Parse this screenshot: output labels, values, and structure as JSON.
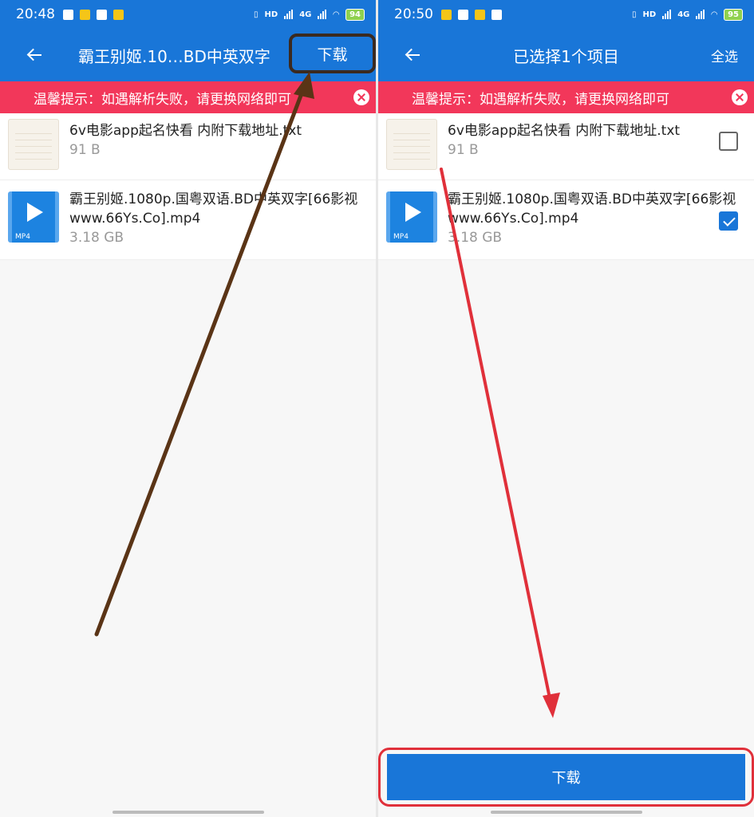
{
  "left": {
    "status": {
      "time": "20:48",
      "battery": "94"
    },
    "toolbar": {
      "title": "霸王别姬.10…BD中英双字",
      "action": "下载"
    },
    "banner": {
      "text": "温馨提示：如遇解析失败，请更换网络即可"
    },
    "files": [
      {
        "name": "6v电影app起名快看 内附下载地址.txt",
        "size": "91 B"
      },
      {
        "name": "霸王别姬.1080p.国粤双语.BD中英双字[66影视www.66Ys.Co].mp4",
        "size": "3.18 GB",
        "badge": "MP4"
      }
    ]
  },
  "right": {
    "status": {
      "time": "20:50",
      "battery": "95"
    },
    "toolbar": {
      "title": "已选择1个项目",
      "action": "全选"
    },
    "banner": {
      "text": "温馨提示：如遇解析失败，请更换网络即可"
    },
    "files": [
      {
        "name": "6v电影app起名快看 内附下载地址.txt",
        "size": "91 B",
        "checked": false
      },
      {
        "name": "霸王别姬.1080p.国粤双语.BD中英双字[66影视www.66Ys.Co].mp4",
        "size": "3.18 GB",
        "badge": "MP4",
        "checked": true
      }
    ],
    "download_button": "下载"
  },
  "status_icons": {
    "hd": "HD",
    "net1": "4G",
    "net2": "4G"
  },
  "colors": {
    "primary": "#1976d8",
    "banner": "#f2375a",
    "annotation_brown": "#5a3416",
    "annotation_red": "#e0303a"
  }
}
